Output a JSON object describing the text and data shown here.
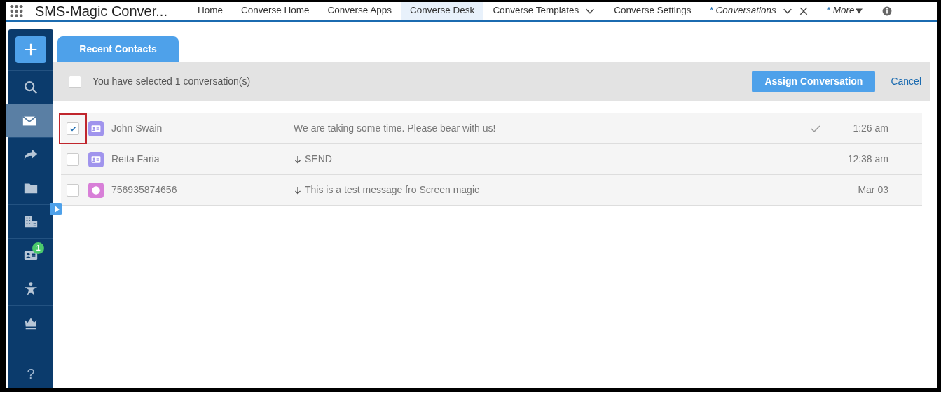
{
  "app": {
    "title": "SMS-Magic Conver..."
  },
  "nav_tabs": [
    {
      "label": "Home",
      "selected": false,
      "kind": "plain"
    },
    {
      "label": "Converse Home",
      "selected": false,
      "kind": "plain"
    },
    {
      "label": "Converse Apps",
      "selected": false,
      "kind": "plain"
    },
    {
      "label": "Converse Desk",
      "selected": true,
      "kind": "plain"
    },
    {
      "label": "Converse Templates",
      "selected": false,
      "kind": "menu"
    },
    {
      "label": "Converse Settings",
      "selected": false,
      "kind": "plain"
    },
    {
      "label": "Conversations",
      "marker": "*",
      "selected": false,
      "kind": "closable"
    },
    {
      "label": "More",
      "marker": "*",
      "selected": false,
      "kind": "more"
    }
  ],
  "sidebar": {
    "items": [
      {
        "kind": "search",
        "selected": false
      },
      {
        "kind": "mail",
        "selected": true
      },
      {
        "kind": "forward",
        "selected": false
      },
      {
        "kind": "folder",
        "selected": false
      },
      {
        "kind": "buildings",
        "selected": false
      },
      {
        "kind": "contact",
        "selected": false,
        "badge": "1"
      },
      {
        "kind": "person",
        "selected": false
      },
      {
        "kind": "crown",
        "selected": false
      }
    ],
    "help": "?"
  },
  "content_tabs": [
    {
      "label": "Recent Contacts",
      "selected": true
    }
  ],
  "selection_bar": {
    "checked": false,
    "text": "You have selected 1 conversation(s)",
    "assign_button": "Assign Conversation",
    "cancel_link": "Cancel"
  },
  "conversations": [
    {
      "checked": true,
      "highlighted": true,
      "kind": "contact",
      "color": "#a094ed",
      "name": "John Swain",
      "inbound": false,
      "message": "We are taking some time. Please bear with us!",
      "delivered": true,
      "time": "1:26 am"
    },
    {
      "checked": false,
      "highlighted": false,
      "kind": "contact",
      "color": "#a094ed",
      "name": "Reita Faria",
      "inbound": true,
      "message": "SEND",
      "delivered": false,
      "time": "12:38 am"
    },
    {
      "checked": false,
      "highlighted": false,
      "kind": "circle",
      "color": "#d87fd8",
      "name": "756935874656",
      "inbound": true,
      "message": "This is a test message fro Screen magic",
      "delivered": false,
      "time": "Mar 03"
    }
  ]
}
